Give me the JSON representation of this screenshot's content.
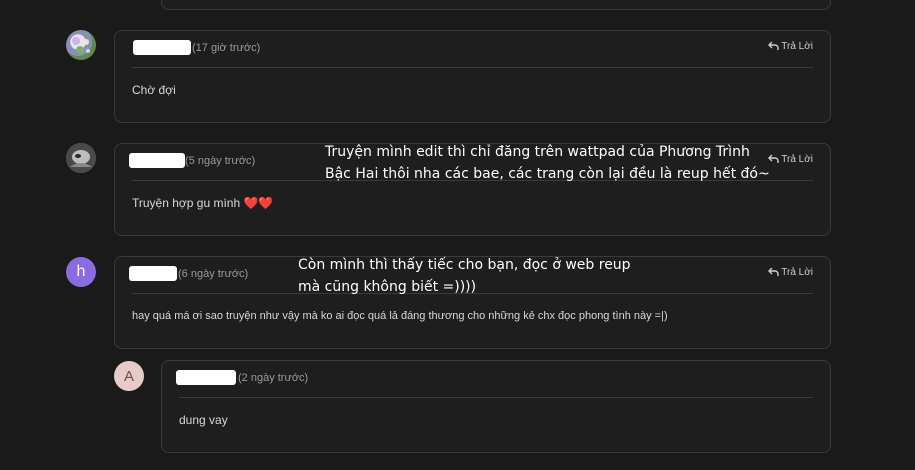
{
  "comments": [
    {
      "time": "(17 giờ trước)",
      "reply_label": "Trả Lời",
      "content": "Chờ đợi",
      "avatar_icon": "patterned-avatar-icon"
    },
    {
      "time": "(5 ngày trước)",
      "reply_label": "Trả Lời",
      "content": "Truyện hợp gu mình ❤️❤️",
      "avatar_icon": "grayscale-photo-avatar-icon"
    },
    {
      "time": "(6 ngày trước)",
      "reply_label": "Trả Lời",
      "content": "hay quá má ơi sao truyện như vậy mà ko ai đọc quá lả đáng thương cho những kẻ chx đọc phong tình này =|)",
      "avatar_letter": "h",
      "avatar_color": "#8b6be0"
    },
    {
      "time": "(2 ngày trước)",
      "content": "dung vay",
      "avatar_letter": "A",
      "avatar_color": "#e6cbc9"
    }
  ],
  "overlay_notes": {
    "note1_line1": "Truyện mình edit thì chỉ đăng trên wattpad của Phương Trình",
    "note1_line2": "Bậc Hai thôi nha các bae, các trang còn lại đều là reup hết đó~",
    "note2_line1": "Còn mình thì thấy tiếc cho bạn, đọc ở web reup",
    "note2_line2": "mà cũng không biết =))))"
  }
}
